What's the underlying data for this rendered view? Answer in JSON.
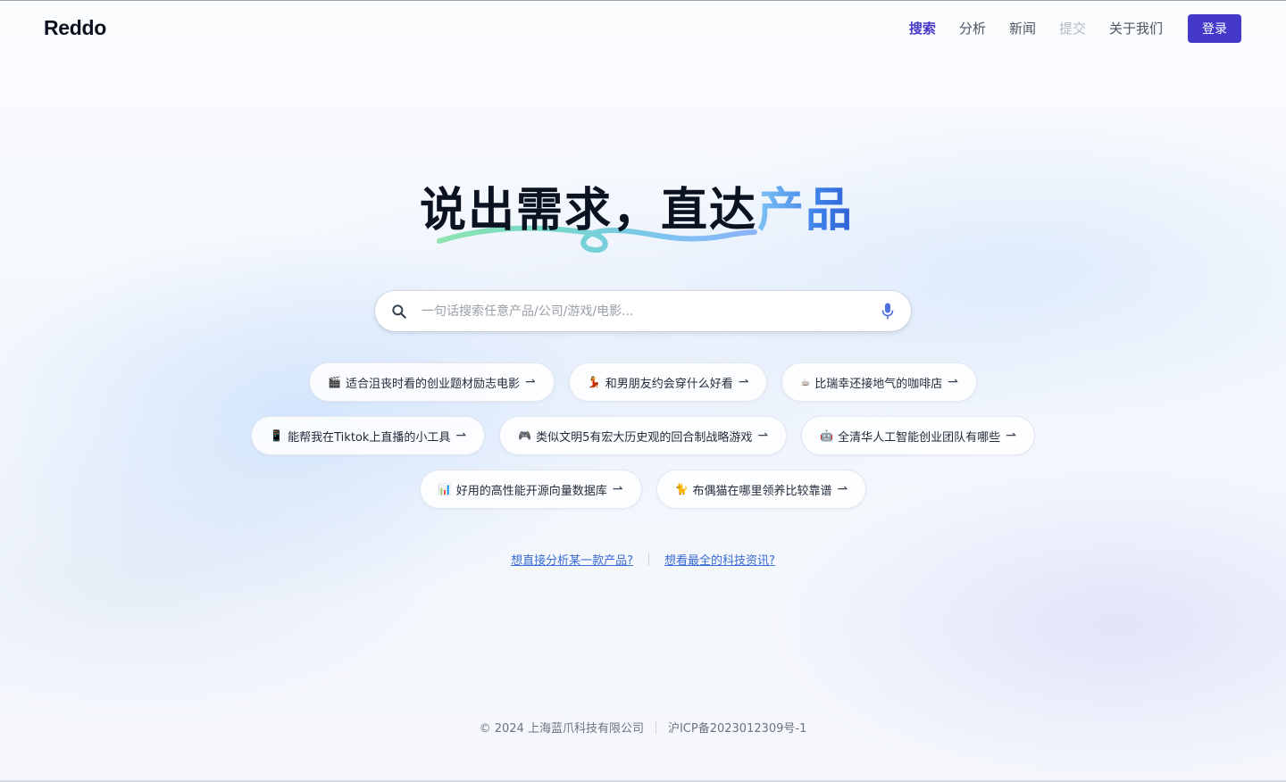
{
  "brand": {
    "logo": "Reddo"
  },
  "nav": {
    "items": [
      {
        "label": "搜索",
        "state": "active"
      },
      {
        "label": "分析",
        "state": "normal"
      },
      {
        "label": "新闻",
        "state": "normal"
      },
      {
        "label": "提交",
        "state": "disabled"
      },
      {
        "label": "关于我们",
        "state": "normal"
      }
    ],
    "login_label": "登录"
  },
  "hero": {
    "title_main": "说出需求，直达",
    "title_highlight": "产品"
  },
  "search": {
    "placeholder": "一句话搜索任意产品/公司/游戏/电影...",
    "value": "",
    "search_icon": "search-icon",
    "voice_icon": "microphone-icon"
  },
  "suggestions": {
    "row1": [
      {
        "emoji": "🎬",
        "text": "适合沮丧时看的创业题材励志电影",
        "arrow": "⇀"
      },
      {
        "emoji": "💃",
        "text": "和男朋友约会穿什么好看",
        "arrow": "⇀"
      },
      {
        "emoji": "☕",
        "text": "比瑞幸还接地气的咖啡店",
        "arrow": "⇀"
      }
    ],
    "row2": [
      {
        "emoji": "📱",
        "text": "能帮我在Tiktok上直播的小工具",
        "arrow": "⇀"
      },
      {
        "emoji": "🎮",
        "text": "类似文明5有宏大历史观的回合制战略游戏",
        "arrow": "⇀"
      },
      {
        "emoji": "🤖",
        "text": "全清华人工智能创业团队有哪些",
        "arrow": "⇀"
      }
    ],
    "row3": [
      {
        "emoji": "📊",
        "text": "好用的高性能开源向量数据库",
        "arrow": "⇀"
      },
      {
        "emoji": "🐈",
        "text": "布偶猫在哪里领养比较靠谱",
        "arrow": "⇀"
      }
    ]
  },
  "links": {
    "analyze": "想直接分析某一款产品?",
    "news": "想看最全的科技资讯?"
  },
  "footer": {
    "copyright": "© 2024 上海蓝爪科技有限公司",
    "icp": "沪ICP备2023012309号-1"
  },
  "colors": {
    "accent": "#4338ca",
    "link": "#3b6bd4",
    "title_gradient_start": "#7ec3f6",
    "title_gradient_end": "#2f5fd6"
  }
}
